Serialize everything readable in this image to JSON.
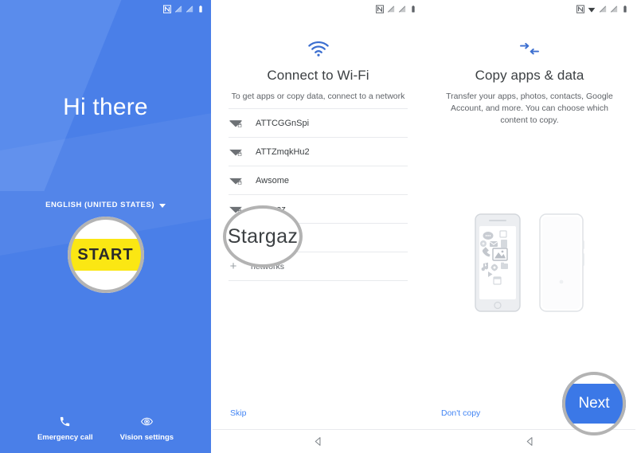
{
  "panels": [
    {
      "id": "welcome",
      "statusbar_icons": [
        "nfc-icon",
        "signal-off-icon",
        "signal-off-icon",
        "battery-icon"
      ],
      "greeting": "Hi there",
      "language": "ENGLISH (UNITED STATES)",
      "start_label": "START",
      "emergency_label": "Emergency call",
      "vision_label": "Vision settings",
      "bg_color": "#4a7fe8",
      "start_color": "#fbe713"
    },
    {
      "id": "wifi",
      "statusbar_icons": [
        "nfc-icon",
        "signal-off-icon",
        "signal-off-icon",
        "battery-icon"
      ],
      "title": "Connect to Wi-Fi",
      "subtitle": "To get apps or copy data, connect to a network",
      "networks": [
        {
          "ssid": "ATTCGGnSpi",
          "secured": true
        },
        {
          "ssid": "ATTZmqkHu2",
          "secured": true
        },
        {
          "ssid": "Awsome",
          "secured": true
        },
        {
          "ssid": "Stargaz",
          "secured": true
        },
        {
          "ssid": "",
          "secured": true
        }
      ],
      "add_network_label": "networks",
      "magnified_text": "Stargaz",
      "skip_label": "Skip",
      "accent_color": "#4285f4"
    },
    {
      "id": "copy",
      "statusbar_icons": [
        "nfc-icon",
        "wifi-icon",
        "signal-off-icon",
        "signal-off-icon",
        "battery-icon"
      ],
      "title": "Copy apps & data",
      "subtitle": "Transfer your apps, photos, contacts, Google Account, and more. You can choose which content to copy.",
      "dont_copy_label": "Don't copy",
      "next_label": "Next",
      "next_color": "#3b78e7",
      "illustration": {
        "source_device": "old-phone",
        "target_device": "new-phone",
        "content_icons": [
          "chat-icon",
          "document-icon",
          "mail-icon",
          "location-icon",
          "phone-icon",
          "photo-icon",
          "music-icon",
          "gear-icon",
          "folder-icon",
          "play-icon",
          "calendar-icon"
        ]
      }
    }
  ]
}
